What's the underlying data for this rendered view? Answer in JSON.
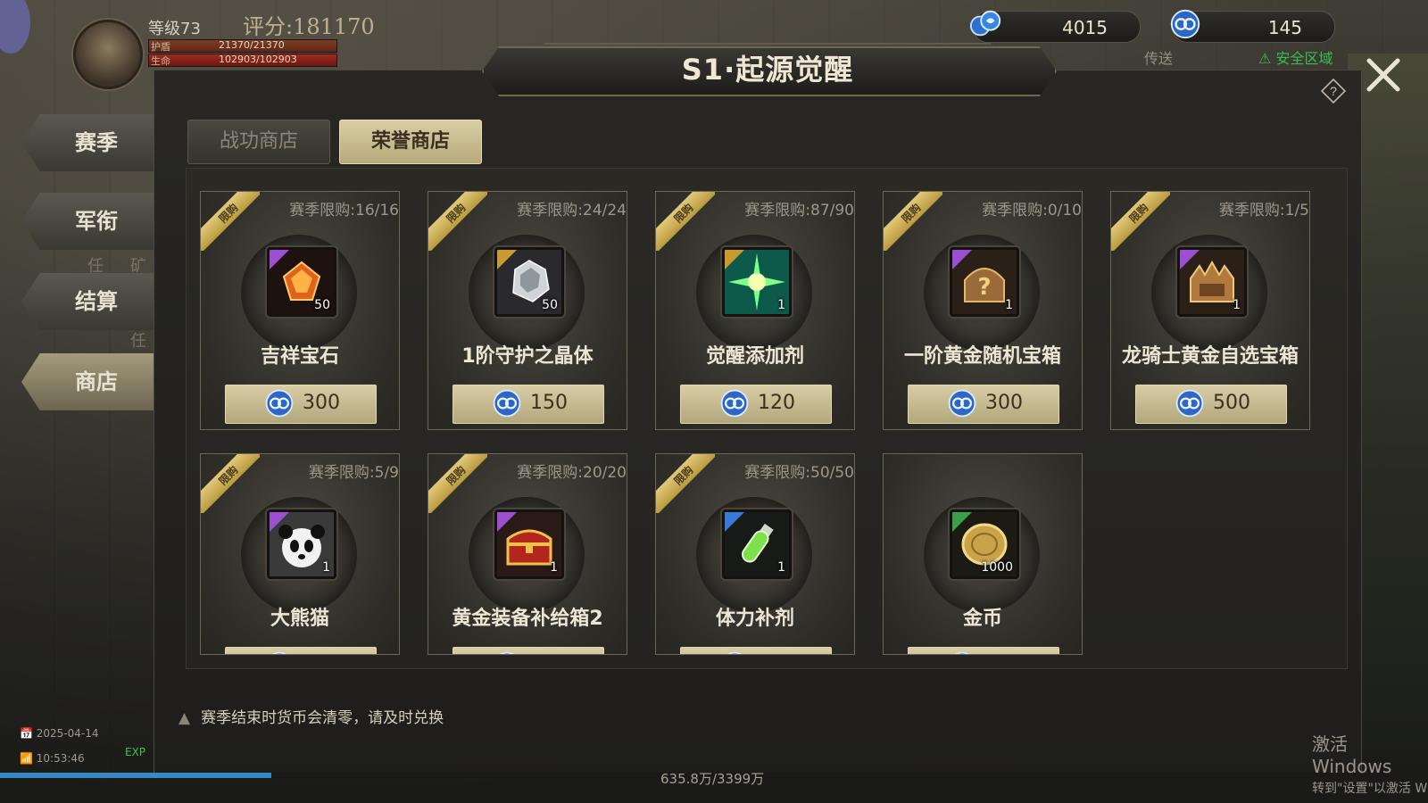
{
  "hud": {
    "level": "等级73",
    "score": "评分:181170",
    "shield_label": "护盾",
    "shield_value": "21370/21370",
    "life_label": "生命",
    "life_value": "102903/102903"
  },
  "currencies": [
    {
      "icon": "blue-coin-icon",
      "amount": "4015"
    },
    {
      "icon": "honor-coin-icon",
      "amount": "145"
    }
  ],
  "header": {
    "title": "S1·起源觉醒",
    "teleport": "传送",
    "safe_zone": "安全区域"
  },
  "tabs": [
    {
      "label": "战功商店",
      "active": false
    },
    {
      "label": "荣誉商店",
      "active": true
    }
  ],
  "sidebar": {
    "items": [
      {
        "label": "赛季",
        "active": false
      },
      {
        "label": "军衔",
        "active": false
      },
      {
        "label": "结算",
        "active": false
      },
      {
        "label": "商店",
        "active": true
      }
    ],
    "fragments": [
      "任",
      "矿",
      "任"
    ]
  },
  "shop": {
    "badge_label": "限购",
    "items": [
      {
        "name": "吉祥宝石",
        "limit": "赛季限购:16/16",
        "qty": "50",
        "price": "300",
        "icon": "gem-icon",
        "rarity": "purple"
      },
      {
        "name": "1阶守护之晶体",
        "limit": "赛季限购:24/24",
        "qty": "50",
        "price": "150",
        "icon": "crystal-icon",
        "rarity": "gold"
      },
      {
        "name": "觉醒添加剂",
        "limit": "赛季限购:87/90",
        "qty": "1",
        "price": "120",
        "icon": "burst-icon",
        "rarity": "gold"
      },
      {
        "name": "一阶黄金随机宝箱",
        "limit": "赛季限购:0/10",
        "qty": "1",
        "price": "300",
        "icon": "mystery-chest-icon",
        "rarity": "purple"
      },
      {
        "name": "龙骑士黄金自选宝箱",
        "limit": "赛季限购:1/5",
        "qty": "1",
        "price": "500",
        "icon": "dragon-chest-icon",
        "rarity": "purple"
      },
      {
        "name": "大熊猫",
        "limit": "赛季限购:5/9",
        "qty": "1",
        "price": "",
        "icon": "panda-icon",
        "rarity": "purple"
      },
      {
        "name": "黄金装备补给箱2",
        "limit": "赛季限购:20/20",
        "qty": "1",
        "price": "",
        "icon": "treasure-chest-icon",
        "rarity": "purple"
      },
      {
        "name": "体力补剂",
        "limit": "赛季限购:50/50",
        "qty": "1",
        "price": "",
        "icon": "potion-icon",
        "rarity": "blue"
      },
      {
        "name": "金币",
        "limit": "",
        "qty": "1000",
        "price": "",
        "icon": "gold-coin-icon",
        "rarity": "green"
      }
    ]
  },
  "warning": "赛季结束时货币会清零，请及时兑换",
  "status": {
    "date": "2025-04-14",
    "time": "10:53:46",
    "exp_label": "EXP",
    "exp_text": "635.8万/3399万",
    "exp_progress": 0.19
  },
  "watermark": {
    "line1": "激活 Windows",
    "line2": "转到\"设置\"以激活 W"
  }
}
